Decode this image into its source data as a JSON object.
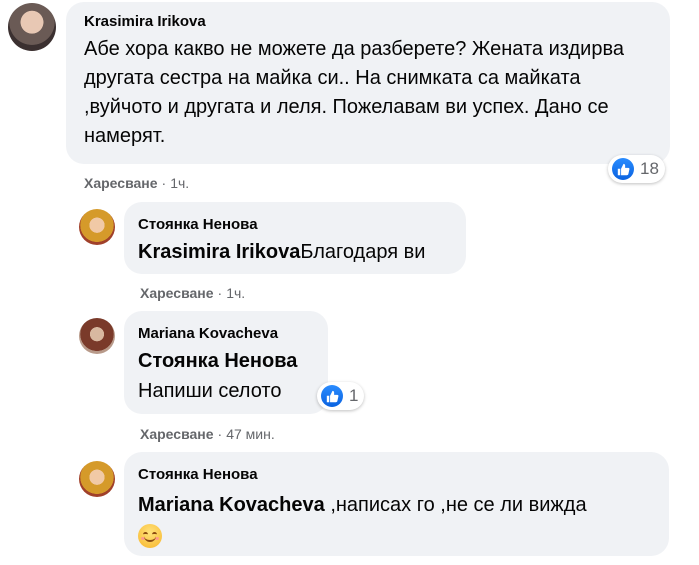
{
  "comments": [
    {
      "author": "Krasimira Irikova",
      "text": "Абе хора какво не можете да разберете? Жената издирва другата сестра на майка си.. На снимката са майката ,вуйчото и другата и леля. Пожелавам ви успех. Дано се намерят.",
      "meta": {
        "like": "Харесване",
        "sep": "·",
        "time": "1ч."
      },
      "reactions": {
        "count": "18",
        "icon": "like-icon"
      }
    },
    {
      "author": "Стоянка Ненова",
      "mention": "Krasimira Irikova",
      "text": "Благодаря ви",
      "meta": {
        "like": "Харесване",
        "sep": "·",
        "time": "1ч."
      }
    },
    {
      "author": "Mariana Kovacheva",
      "mention": "Стоянка Ненова",
      "text": "Напиши селото",
      "meta": {
        "like": "Харесване",
        "sep": "·",
        "time": "47 мин."
      },
      "reactions": {
        "count": "1",
        "icon": "like-icon"
      }
    },
    {
      "author": "Стоянка Ненова",
      "mention": "Mariana Kovacheva",
      "text": " ,написах го ,не се ли вижда",
      "emoji": "smiling-face-emoji"
    }
  ],
  "colors": {
    "bubble": "#f0f2f5",
    "meta": "#65676b",
    "like_blue": "#1877f2"
  }
}
